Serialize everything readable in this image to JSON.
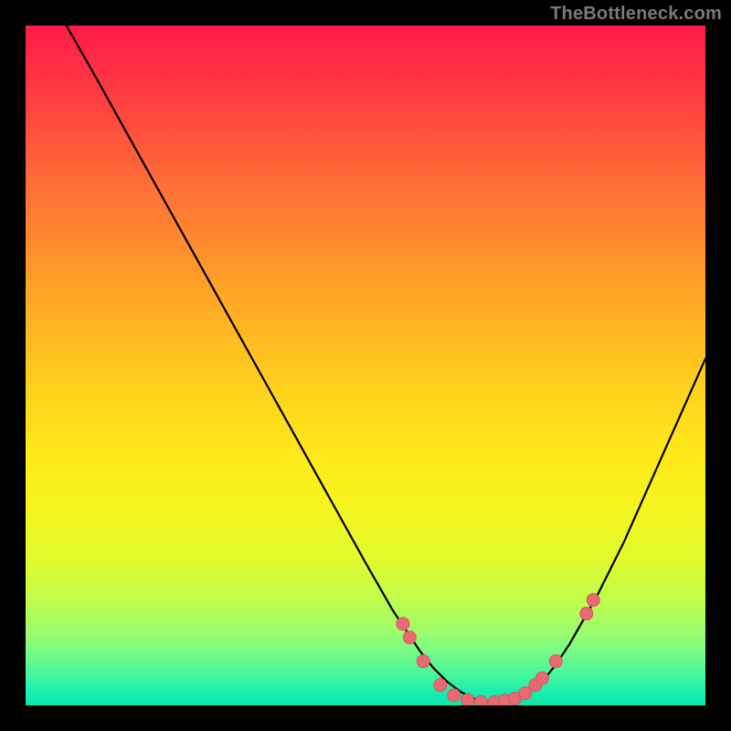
{
  "watermark": "TheBottleneck.com",
  "colors": {
    "background": "#000000",
    "curve": "#000000",
    "dot_fill": "#e86a72",
    "dot_stroke": "#d85262"
  },
  "chart_data": {
    "type": "line",
    "title": "",
    "xlabel": "",
    "ylabel": "",
    "xlim": [
      0,
      100
    ],
    "ylim": [
      0,
      100
    ],
    "grid": false,
    "legend": false,
    "annotations": [],
    "series": [
      {
        "name": "bottleneck-curve",
        "x": [
          6,
          10,
          15,
          20,
          25,
          30,
          35,
          40,
          45,
          50,
          54,
          56,
          58,
          60,
          62,
          64,
          66,
          68,
          70,
          72,
          74,
          76,
          78,
          80,
          84,
          88,
          92,
          96,
          100
        ],
        "y": [
          100,
          93,
          84,
          75,
          66,
          57,
          48,
          39,
          30,
          21,
          14,
          11,
          8,
          5.5,
          3.5,
          2,
          1,
          0.5,
          0.5,
          1,
          2,
          3.5,
          6,
          9,
          16,
          24,
          33,
          42,
          51
        ]
      }
    ],
    "scatter_points": {
      "name": "highlighted-points",
      "points": [
        {
          "x": 55.5,
          "y": 12.0
        },
        {
          "x": 56.5,
          "y": 10.0
        },
        {
          "x": 58.5,
          "y": 6.5
        },
        {
          "x": 61.0,
          "y": 3.0
        },
        {
          "x": 63.0,
          "y": 1.5
        },
        {
          "x": 65.0,
          "y": 0.8
        },
        {
          "x": 67.0,
          "y": 0.5
        },
        {
          "x": 69.0,
          "y": 0.5
        },
        {
          "x": 70.5,
          "y": 0.7
        },
        {
          "x": 72.0,
          "y": 1.0
        },
        {
          "x": 73.5,
          "y": 1.8
        },
        {
          "x": 75.0,
          "y": 3.0
        },
        {
          "x": 76.0,
          "y": 4.0
        },
        {
          "x": 78.0,
          "y": 6.5
        },
        {
          "x": 82.5,
          "y": 13.5
        },
        {
          "x": 83.5,
          "y": 15.5
        }
      ]
    }
  }
}
